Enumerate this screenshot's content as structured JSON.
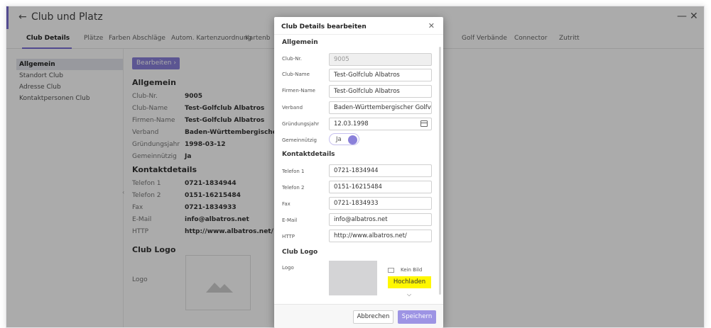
{
  "app": {
    "title": "Club und Platz",
    "back_icon": "arrow-left-icon",
    "minimize_glyph": "—",
    "close_glyph": "✕",
    "accent": "#7b6fd6"
  },
  "tabs": [
    {
      "label": "Club Details"
    },
    {
      "label": "Plätze"
    },
    {
      "label": "Farben Abschläge"
    },
    {
      "label": "Autom. Kartenzuordnung"
    },
    {
      "label": "Kartenb"
    },
    {
      "label": "Golf Verbände"
    },
    {
      "label": "Connector"
    },
    {
      "label": "Zutritt"
    }
  ],
  "sidebar": {
    "items": [
      {
        "label": "Allgemein"
      },
      {
        "label": "Standort Club"
      },
      {
        "label": "Adresse Club"
      },
      {
        "label": "Kontaktpersonen Club"
      }
    ]
  },
  "detail": {
    "edit_button": "Bearbeiten",
    "section_general": "Allgemein",
    "general_rows": [
      {
        "key": "Club-Nr.",
        "value": "9005"
      },
      {
        "key": "Club-Name",
        "value": "Test-Golfclub Albatros"
      },
      {
        "key": "Firmen-Name",
        "value": "Test-Golfclub Albatros"
      },
      {
        "key": "Verband",
        "value": "Baden-Württembergischer Golfver"
      },
      {
        "key": "Gründungsjahr",
        "value": "1998-03-12"
      },
      {
        "key": "Gemeinnützig",
        "value": "Ja"
      }
    ],
    "section_contact": "Kontaktdetails",
    "contact_rows": [
      {
        "key": "Telefon 1",
        "value": "0721-1834944"
      },
      {
        "key": "Telefon 2",
        "value": "0151-16215484"
      },
      {
        "key": "Fax",
        "value": "0721-1834933"
      },
      {
        "key": "E-Mail",
        "value": "info@albatros.net"
      },
      {
        "key": "HTTP",
        "value": "http://www.albatros.net/"
      }
    ],
    "section_logo": "Club Logo",
    "logo_label": "Logo"
  },
  "dialog": {
    "title": "Club Details bearbeiten",
    "close_glyph": "✕",
    "section_general": "Allgemein",
    "fields": {
      "club_nr": {
        "label": "Club-Nr.",
        "value": "9005"
      },
      "club_name": {
        "label": "Club-Name",
        "value": "Test-Golfclub Albatros"
      },
      "firmen_name": {
        "label": "Firmen-Name",
        "value": "Test-Golfclub Albatros"
      },
      "verband": {
        "label": "Verband",
        "value": "Baden-Württembergischer Golfv ..."
      },
      "gruendungsjahr": {
        "label": "Gründungsjahr",
        "value": "12.03.1998"
      },
      "gemeinnuetzig": {
        "label": "Gemeinnützig",
        "value": "Ja"
      }
    },
    "section_contact": "Kontaktdetails",
    "contact": {
      "telefon1": {
        "label": "Telefon 1",
        "value": "0721-1834944"
      },
      "telefon2": {
        "label": "Telefon 2",
        "value": "0151-16215484"
      },
      "fax": {
        "label": "Fax",
        "value": "0721-1834933"
      },
      "email": {
        "label": "E-Mail",
        "value": "info@albatros.net"
      },
      "http": {
        "label": "HTTP",
        "value": "http://www.albatros.net/"
      }
    },
    "section_logo": "Club Logo",
    "logo_label": "Logo",
    "no_image": "Kein Bild",
    "upload_button": "Hochladen",
    "cancel_button": "Abbrechen",
    "save_button": "Speichern",
    "upload_color": "#fff700",
    "save_color": "#9d94e4"
  }
}
